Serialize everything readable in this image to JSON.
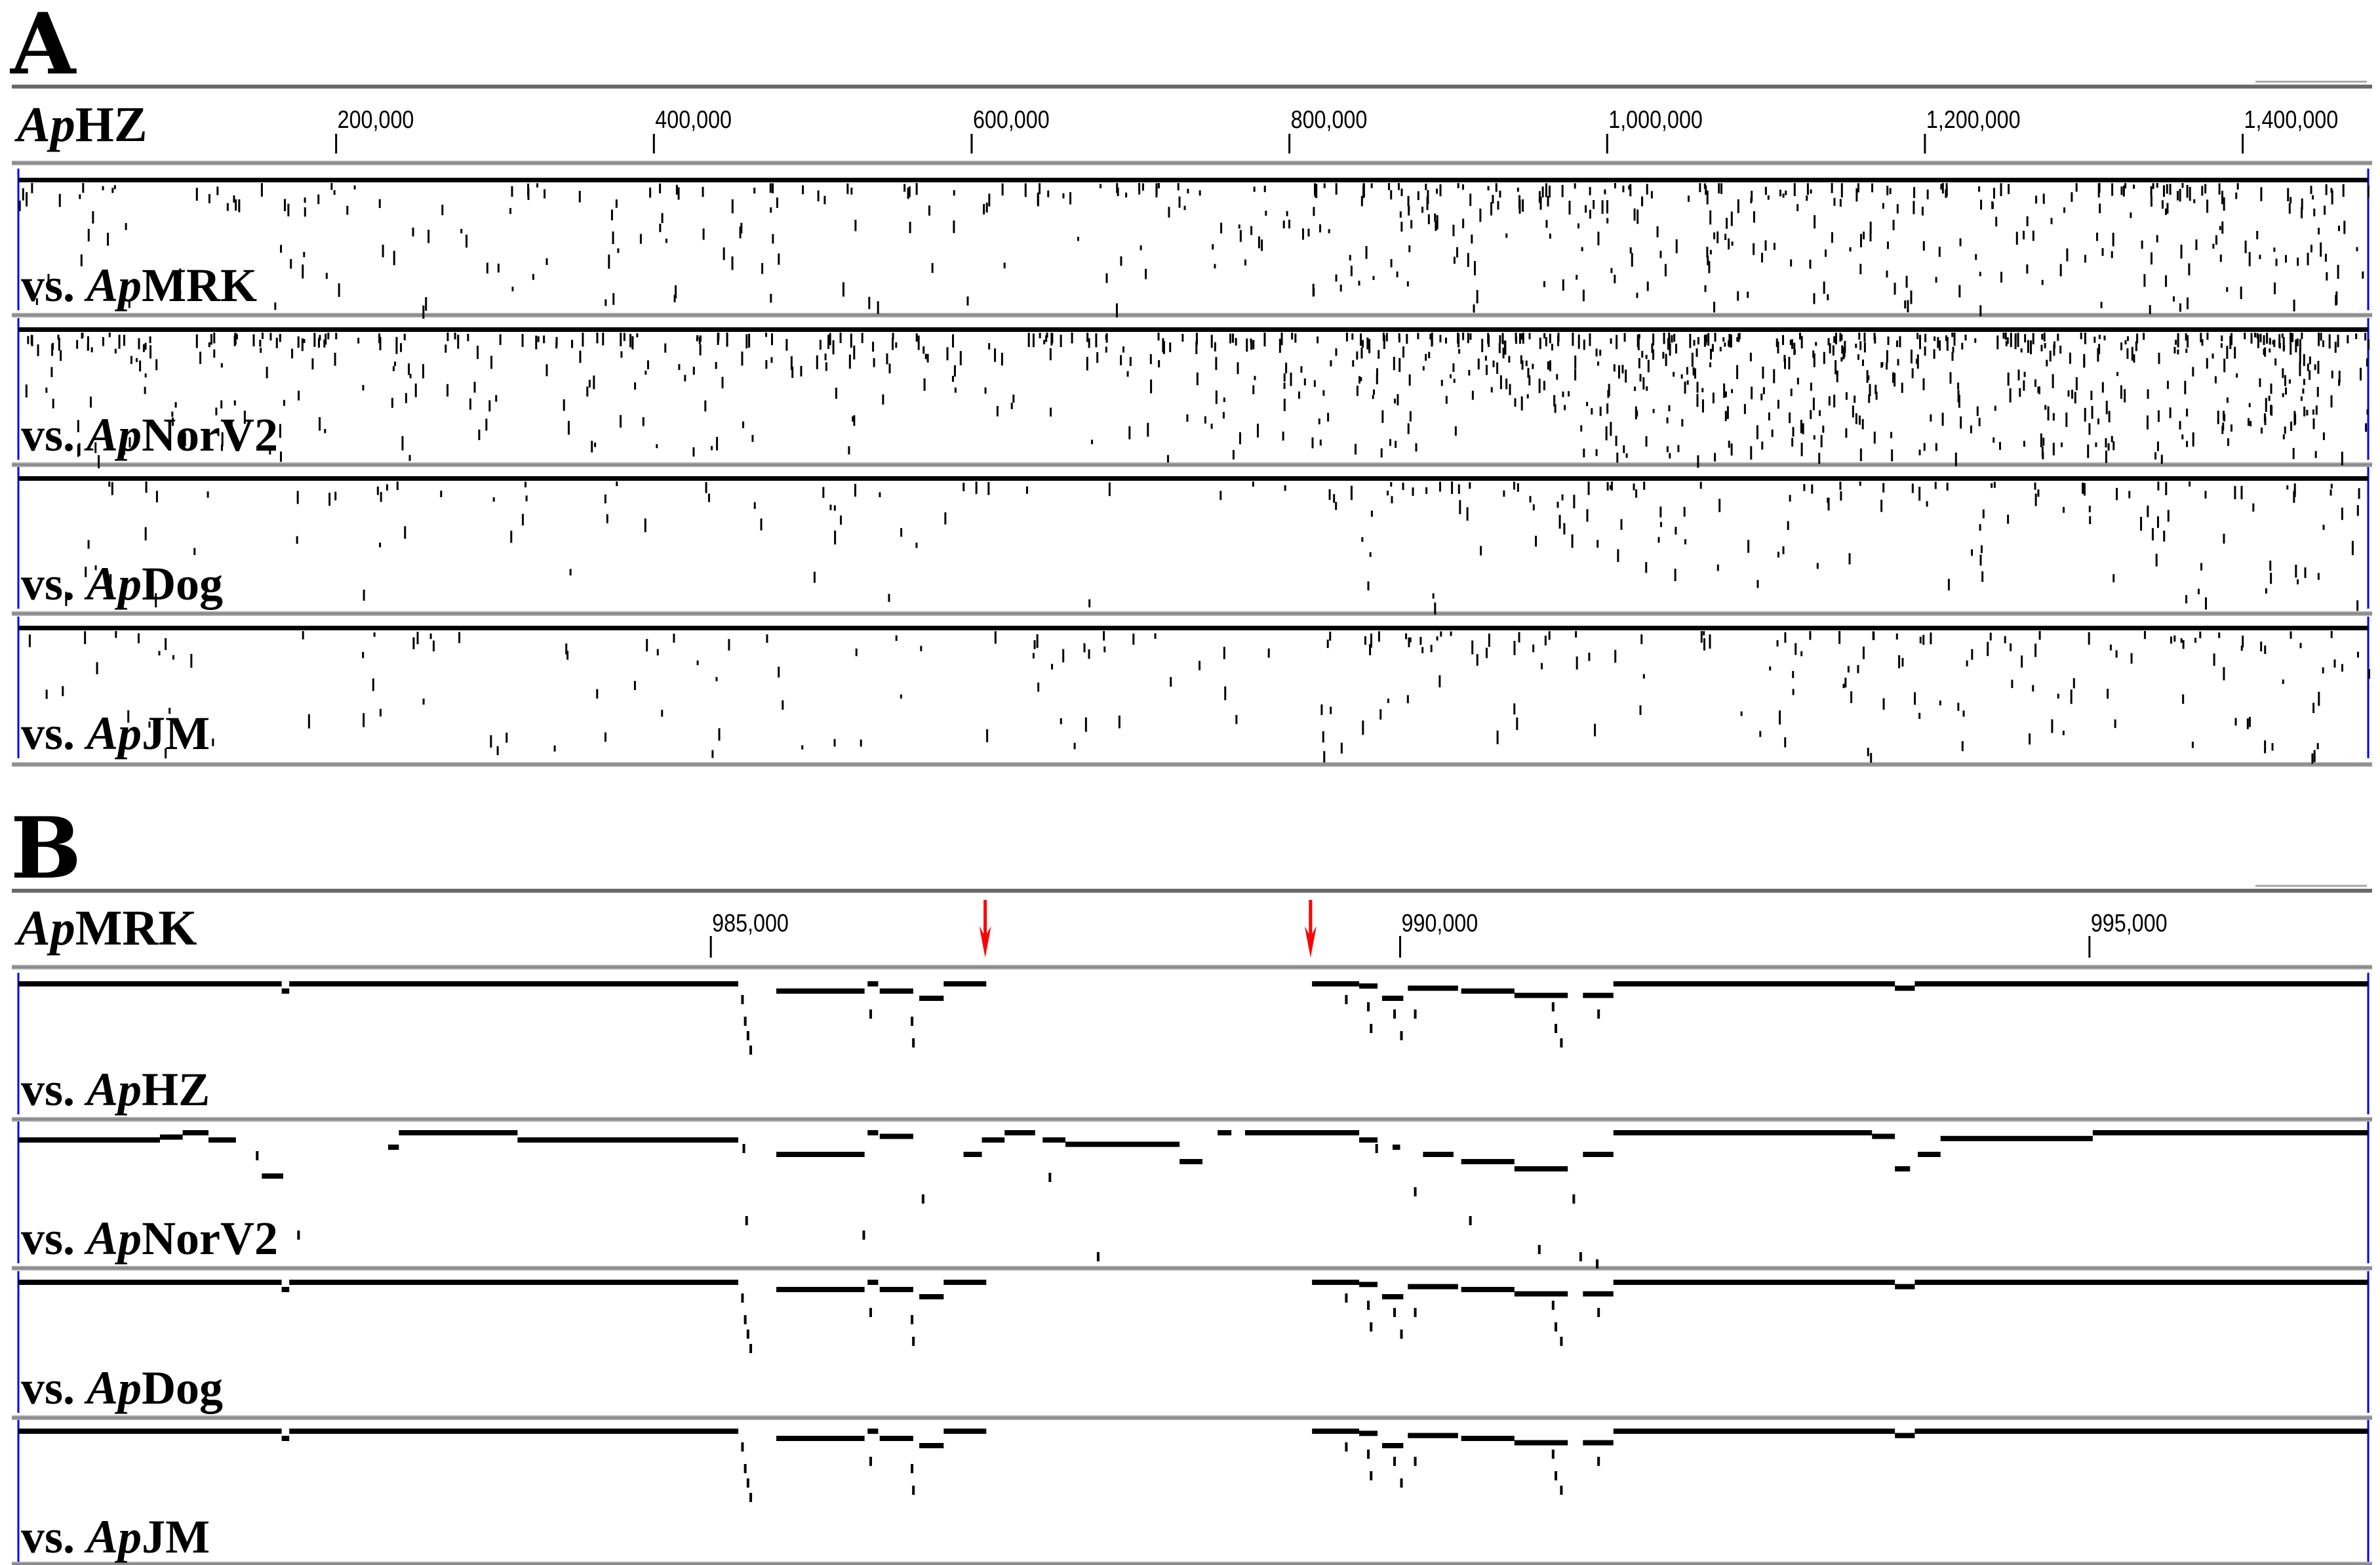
{
  "panels": [
    {
      "letter": "A",
      "reference": {
        "italic": "Ap",
        "rest": "HZ"
      },
      "axis": {
        "start": 0,
        "end": 1479000,
        "ticks": [
          {
            "value": 200000,
            "label": "200,000"
          },
          {
            "value": 400000,
            "label": "400,000"
          },
          {
            "value": 600000,
            "label": "600,000"
          },
          {
            "value": 800000,
            "label": "800,000"
          },
          {
            "value": 1000000,
            "label": "1,000,000"
          },
          {
            "value": 1200000,
            "label": "1,200,000"
          },
          {
            "value": 1400000,
            "label": "1,400,000"
          }
        ]
      },
      "tracks": [
        {
          "prefix": "vs. ",
          "italic": "Ap",
          "rest": "MRK",
          "variant_density": 0.55
        },
        {
          "prefix": "vs. ",
          "italic": "Ap",
          "rest": "NorV2",
          "variant_density": 1.0
        },
        {
          "prefix": "vs. ",
          "italic": "Ap",
          "rest": "Dog",
          "variant_density": 0.22
        },
        {
          "prefix": "vs. ",
          "italic": "Ap",
          "rest": "JM",
          "variant_density": 0.25
        }
      ]
    },
    {
      "letter": "B",
      "reference": {
        "italic": "Ap",
        "rest": "MRK"
      },
      "axis": {
        "start": 979977,
        "end": 997022,
        "ticks": [
          {
            "value": 985000,
            "label": "985,000"
          },
          {
            "value": 990000,
            "label": "990,000"
          },
          {
            "value": 995000,
            "label": "995,000"
          }
        ]
      },
      "arrows": [
        986990,
        989350
      ],
      "arrow_color": "#ff0000",
      "tracks": [
        {
          "prefix": "vs. ",
          "italic": "Ap",
          "rest": "HZ",
          "pattern": "common"
        },
        {
          "prefix": "vs. ",
          "italic": "Ap",
          "rest": "NorV2",
          "pattern": "norv2"
        },
        {
          "prefix": "vs. ",
          "italic": "Ap",
          "rest": "Dog",
          "pattern": "common"
        },
        {
          "prefix": "vs. ",
          "italic": "Ap",
          "rest": "JM",
          "pattern": "common"
        }
      ],
      "blocks": {
        "common": [
          [
            979977,
            981887,
            0
          ],
          [
            981887,
            981942,
            1
          ],
          [
            981942,
            985199,
            0
          ],
          [
            985475,
            986115,
            1
          ],
          [
            986137,
            986214,
            0
          ],
          [
            986225,
            986468,
            1
          ],
          [
            986512,
            986689,
            2
          ],
          [
            986689,
            986998,
            0
          ],
          [
            989361,
            989703,
            0
          ],
          [
            989703,
            989836,
            0.3
          ],
          [
            989869,
            990023,
            2
          ],
          [
            990056,
            990420,
            0.6
          ],
          [
            990443,
            990829,
            1
          ],
          [
            990829,
            991216,
            1.6
          ],
          [
            991326,
            991547,
            1.6
          ],
          [
            991547,
            993589,
            0
          ],
          [
            993589,
            993733,
            0.6
          ],
          [
            993733,
            997022,
            0
          ]
        ],
        "norv2": [
          [
            979977,
            981004,
            1
          ],
          [
            981004,
            981169,
            0.6
          ],
          [
            981169,
            981356,
            0
          ],
          [
            981356,
            981555,
            1
          ],
          [
            981743,
            981898,
            6
          ],
          [
            982659,
            982737,
            2
          ],
          [
            982737,
            983598,
            0
          ],
          [
            983598,
            985199,
            1
          ],
          [
            985475,
            986115,
            3
          ],
          [
            986137,
            986214,
            0
          ],
          [
            986225,
            986468,
            0.5
          ],
          [
            986833,
            986966,
            3
          ],
          [
            986966,
            987131,
            1
          ],
          [
            987131,
            987352,
            0
          ],
          [
            987407,
            987572,
            1
          ],
          [
            987572,
            988400,
            1.6
          ],
          [
            988400,
            988566,
            4
          ],
          [
            988676,
            988776,
            0
          ],
          [
            988875,
            989703,
            0
          ],
          [
            989703,
            989836,
            1
          ],
          [
            989945,
            990000,
            2
          ],
          [
            990166,
            990387,
            3
          ],
          [
            990443,
            990829,
            4
          ],
          [
            990829,
            991216,
            5
          ],
          [
            991326,
            991547,
            3
          ],
          [
            991547,
            993423,
            0
          ],
          [
            993423,
            993589,
            0.5
          ],
          [
            993589,
            993699,
            5
          ],
          [
            993755,
            993920,
            3
          ],
          [
            993920,
            995024,
            0.8
          ],
          [
            995024,
            997022,
            0
          ]
        ]
      },
      "ticks_bp": {
        "common": [
          [
            985220,
            2
          ],
          [
            985240,
            5
          ],
          [
            985260,
            7
          ],
          [
            985280,
            9
          ],
          [
            986150,
            4
          ],
          [
            986450,
            5
          ],
          [
            986460,
            8
          ],
          [
            989600,
            2
          ],
          [
            989760,
            3
          ],
          [
            989780,
            6
          ],
          [
            989950,
            4
          ],
          [
            990000,
            7
          ],
          [
            990100,
            4
          ],
          [
            991100,
            3
          ],
          [
            991120,
            6
          ],
          [
            991160,
            8
          ],
          [
            991430,
            4
          ]
        ],
        "norv2": [
          [
            981700,
            3
          ],
          [
            982000,
            14
          ],
          [
            985230,
            2
          ],
          [
            985250,
            12
          ],
          [
            986100,
            14
          ],
          [
            986530,
            9
          ],
          [
            987450,
            6
          ],
          [
            987800,
            17
          ],
          [
            989820,
            2
          ],
          [
            990100,
            8
          ],
          [
            990500,
            12
          ],
          [
            991000,
            16
          ],
          [
            991250,
            9
          ],
          [
            991300,
            17
          ],
          [
            991420,
            18
          ]
        ]
      }
    }
  ],
  "colors": {
    "separator": "#8a8a8a",
    "track_edge": "#0000ff",
    "marks": "#000000"
  }
}
